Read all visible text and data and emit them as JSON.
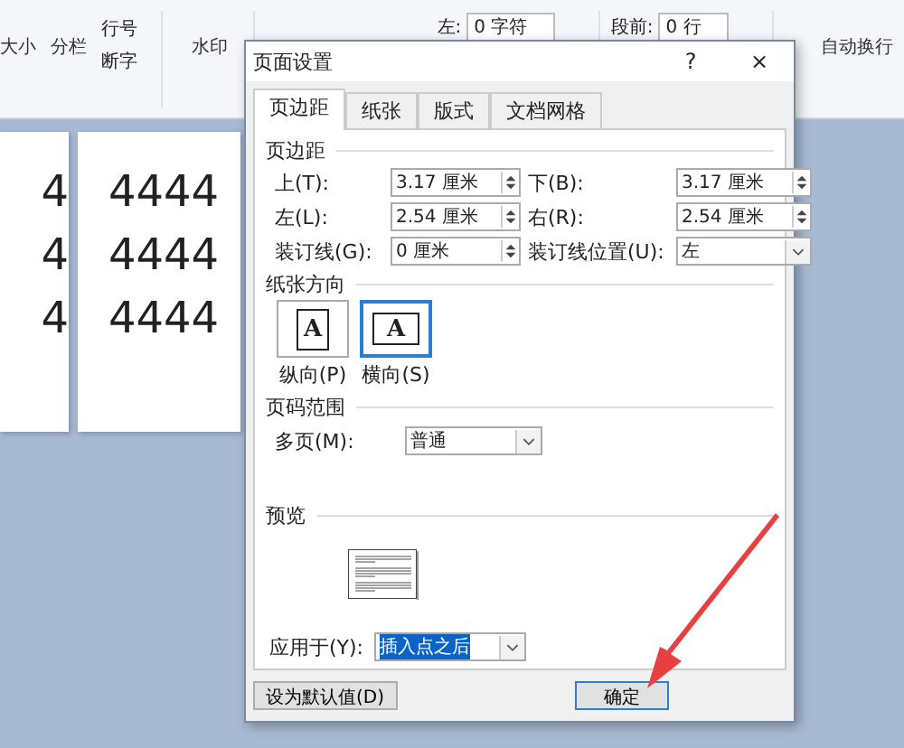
{
  "ribbon": {
    "size": "大小",
    "columns": "分栏",
    "line_numbers": "行号",
    "hyphenation": "断字",
    "watermark": "水印",
    "indent_left_label": "左:",
    "indent_left_value": "0 字符",
    "spacing_before_label": "段前:",
    "spacing_before_value": "0 行",
    "wrap_text": "自动换行"
  },
  "pages": [
    {
      "lines": [
        "4",
        "4",
        "4"
      ]
    },
    {
      "lines": [
        "4444",
        "4444",
        "4444"
      ]
    }
  ],
  "dialog": {
    "title": "页面设置",
    "help": "?",
    "close": "×",
    "tabs": [
      {
        "label": "页边距",
        "selected": true
      },
      {
        "label": "纸张",
        "selected": false
      },
      {
        "label": "版式",
        "selected": false
      },
      {
        "label": "文档网格",
        "selected": false
      }
    ],
    "margins": {
      "heading": "页边距",
      "fields": [
        {
          "label": "上(T):",
          "value": "3.17 厘米",
          "kind": "spin"
        },
        {
          "label": "下(B):",
          "value": "3.17 厘米",
          "kind": "spin"
        },
        {
          "label": "左(L):",
          "value": "2.54 厘米",
          "kind": "spin"
        },
        {
          "label": "右(R):",
          "value": "2.54 厘米",
          "kind": "spin"
        },
        {
          "label": "装订线(G):",
          "value": "0 厘米",
          "kind": "spin"
        },
        {
          "label": "装订线位置(U):",
          "value": "左",
          "kind": "dropdown"
        }
      ]
    },
    "orientation": {
      "heading": "纸张方向",
      "options": [
        {
          "label": "纵向(P)",
          "glyph": "A",
          "kind": "portrait",
          "selected": false
        },
        {
          "label": "横向(S)",
          "glyph": "A",
          "kind": "landscape",
          "selected": true
        }
      ]
    },
    "page_range": {
      "heading": "页码范围",
      "label": "多页(M):",
      "value": "普通"
    },
    "preview": {
      "heading": "预览"
    },
    "apply_to": {
      "label": "应用于(Y):",
      "value": "插入点之后"
    },
    "buttons": [
      {
        "label": "设为默认值(D)",
        "kind": "default"
      },
      {
        "label": "确定",
        "kind": "ok"
      }
    ]
  }
}
